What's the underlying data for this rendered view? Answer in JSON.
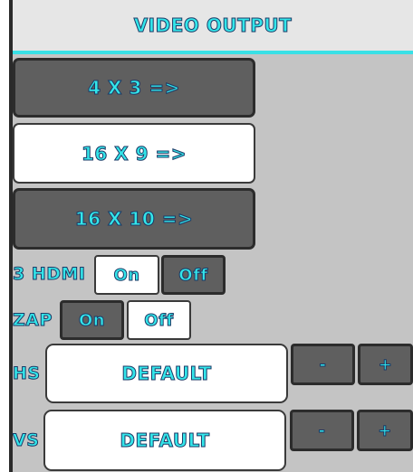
{
  "header": {
    "title": "VIDEO OUTPUT"
  },
  "aspect_buttons": [
    {
      "label": "4 X 3 =>",
      "state": "inactive"
    },
    {
      "label": "16 X 9 =>",
      "state": "selected"
    },
    {
      "label": "16 X 10 =>",
      "state": "inactive"
    }
  ],
  "hdmi": {
    "label": "3 HDMI",
    "on": "On",
    "off": "Off",
    "selected": "on"
  },
  "zap": {
    "label": "ZAP",
    "on": "On",
    "off": "Off",
    "selected": "off"
  },
  "hs": {
    "label": "HS",
    "value": "DEFAULT",
    "minus": "-",
    "plus": "+"
  },
  "vs": {
    "label": "VS",
    "value": "DEFAULT",
    "minus": "-",
    "plus": "+"
  },
  "colors": {
    "accent_text": "#33e6ea",
    "panel": "#c4c4c4",
    "button_dark": "#5f5f5f",
    "button_light": "#ffffff"
  }
}
